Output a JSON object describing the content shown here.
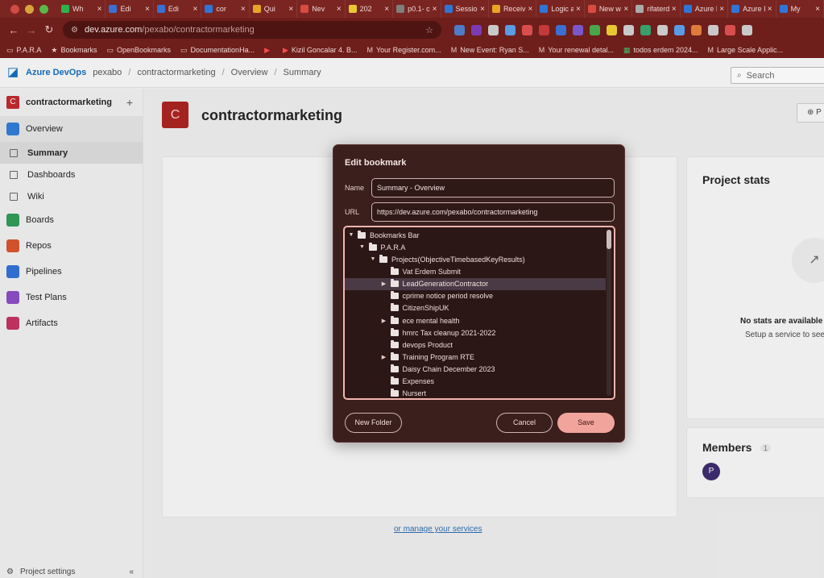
{
  "browser": {
    "tabs": [
      {
        "label": "Wh",
        "color": "#2fb24b"
      },
      {
        "label": "Edi",
        "color": "#3b6fd1"
      },
      {
        "label": "Edi",
        "color": "#3b6fd1"
      },
      {
        "label": "cor",
        "color": "#2f75d8"
      },
      {
        "label": "Qui",
        "color": "#e8a426"
      },
      {
        "label": "Nev",
        "color": "#d94b3e"
      },
      {
        "label": "202",
        "color": "#e8c832"
      },
      {
        "label": "p0.1- c",
        "color": "#7f7f7f"
      },
      {
        "label": "Sessio",
        "color": "#2f75d8"
      },
      {
        "label": "Receiv",
        "color": "#e8a426"
      },
      {
        "label": "Logic a",
        "color": "#2f75d8"
      },
      {
        "label": "New w",
        "color": "#d94b3e"
      },
      {
        "label": "rifaterd",
        "color": "#aaaaaa"
      },
      {
        "label": "Azure I",
        "color": "#2f75d8"
      },
      {
        "label": "Azure I",
        "color": "#2f75d8"
      },
      {
        "label": "My",
        "color": "#2f75d8"
      }
    ],
    "address": {
      "host": "dev.azure.com",
      "path": "/pexabo/contractormarketing"
    },
    "extension_colors": [
      "#4d7cc9",
      "#7b3bb5",
      "#c9c9c9",
      "#5a9be5",
      "#d84e4e",
      "#c43a3a",
      "#3b6fd1",
      "#7a58c9",
      "#4aa64a",
      "#e8c832",
      "#c9c9c9",
      "#38a06a",
      "#c9c9c9",
      "#5a9be5",
      "#e07b39",
      "#c9c9c9",
      "#d84e4e",
      "#c9c9c9"
    ],
    "bookmarks": [
      {
        "label": "P.A.R.A",
        "icon": "folder-icon"
      },
      {
        "label": "Bookmarks",
        "icon": "star-icon"
      },
      {
        "label": "OpenBookmarks",
        "icon": "folder-icon"
      },
      {
        "label": "DocumentationHa...",
        "icon": "folder-icon"
      },
      {
        "label": "",
        "icon": "youtube-icon"
      },
      {
        "label": "Kizil Goncalar 4. B...",
        "icon": "youtube-icon"
      },
      {
        "label": "Your Register.com...",
        "icon": "gmail-icon"
      },
      {
        "label": "New Event: Ryan S...",
        "icon": "gmail-icon"
      },
      {
        "label": "Your renewal detal...",
        "icon": "gmail-icon"
      },
      {
        "label": "todos erdem 2024...",
        "icon": "sheets-icon"
      },
      {
        "label": "Large Scale Applic...",
        "icon": "gmail-icon"
      }
    ]
  },
  "ado": {
    "brand": "Azure DevOps",
    "breadcrumb": [
      "pexabo",
      "contractormarketing",
      "Overview",
      "Summary"
    ],
    "search_placeholder": "Search",
    "project_initial": "C",
    "project_name": "contractormarketing",
    "nav": [
      {
        "label": "Overview",
        "color": "#2f7bd6",
        "selected": true
      },
      {
        "label": "Summary",
        "sub": true,
        "selected": true
      },
      {
        "label": "Dashboards",
        "sub": true
      },
      {
        "label": "Wiki",
        "sub": true
      },
      {
        "label": "Boards",
        "color": "#2e9a55"
      },
      {
        "label": "Repos",
        "color": "#d9532b"
      },
      {
        "label": "Pipelines",
        "color": "#2f6fd6"
      },
      {
        "label": "Test Plans",
        "color": "#8a4bc2"
      },
      {
        "label": "Artifacts",
        "color": "#c2305f"
      }
    ],
    "project_settings": "Project settings",
    "privacy_label": "P",
    "manage_link": "or manage your services",
    "stats_title": "Project stats",
    "no_stats": "No stats are available",
    "setup_service": "Setup a service to see",
    "members_title": "Members",
    "members_count": "1",
    "member_initial": "P"
  },
  "dialog": {
    "title": "Edit bookmark",
    "name_label": "Name",
    "name_value": "Summary - Overview",
    "url_label": "URL",
    "url_value": "https://dev.azure.com/pexabo/contractormarketing",
    "tree": [
      {
        "label": "Bookmarks Bar",
        "depth": 0,
        "expanded": true
      },
      {
        "label": "P.A.R.A",
        "depth": 1,
        "expanded": true
      },
      {
        "label": "Projects(ObjectiveTimebasedKeyResults)",
        "depth": 2,
        "expanded": true
      },
      {
        "label": "Vat Erdem Submit",
        "depth": 3
      },
      {
        "label": "LeadGenerationContractor",
        "depth": 3,
        "collapsed": true,
        "selected": true
      },
      {
        "label": "cprime notice period resolve",
        "depth": 3
      },
      {
        "label": "CitizenShipUK",
        "depth": 3
      },
      {
        "label": "ece mental health",
        "depth": 3,
        "collapsed": true
      },
      {
        "label": "hmrc Tax cleanup 2021-2022",
        "depth": 3
      },
      {
        "label": "devops Product",
        "depth": 3
      },
      {
        "label": "Training Program RTE",
        "depth": 3,
        "collapsed": true
      },
      {
        "label": "Daisy Chain December 2023",
        "depth": 3
      },
      {
        "label": "Expenses",
        "depth": 3
      },
      {
        "label": "Nursert",
        "depth": 3
      }
    ],
    "new_folder": "New Folder",
    "cancel": "Cancel",
    "save": "Save"
  }
}
